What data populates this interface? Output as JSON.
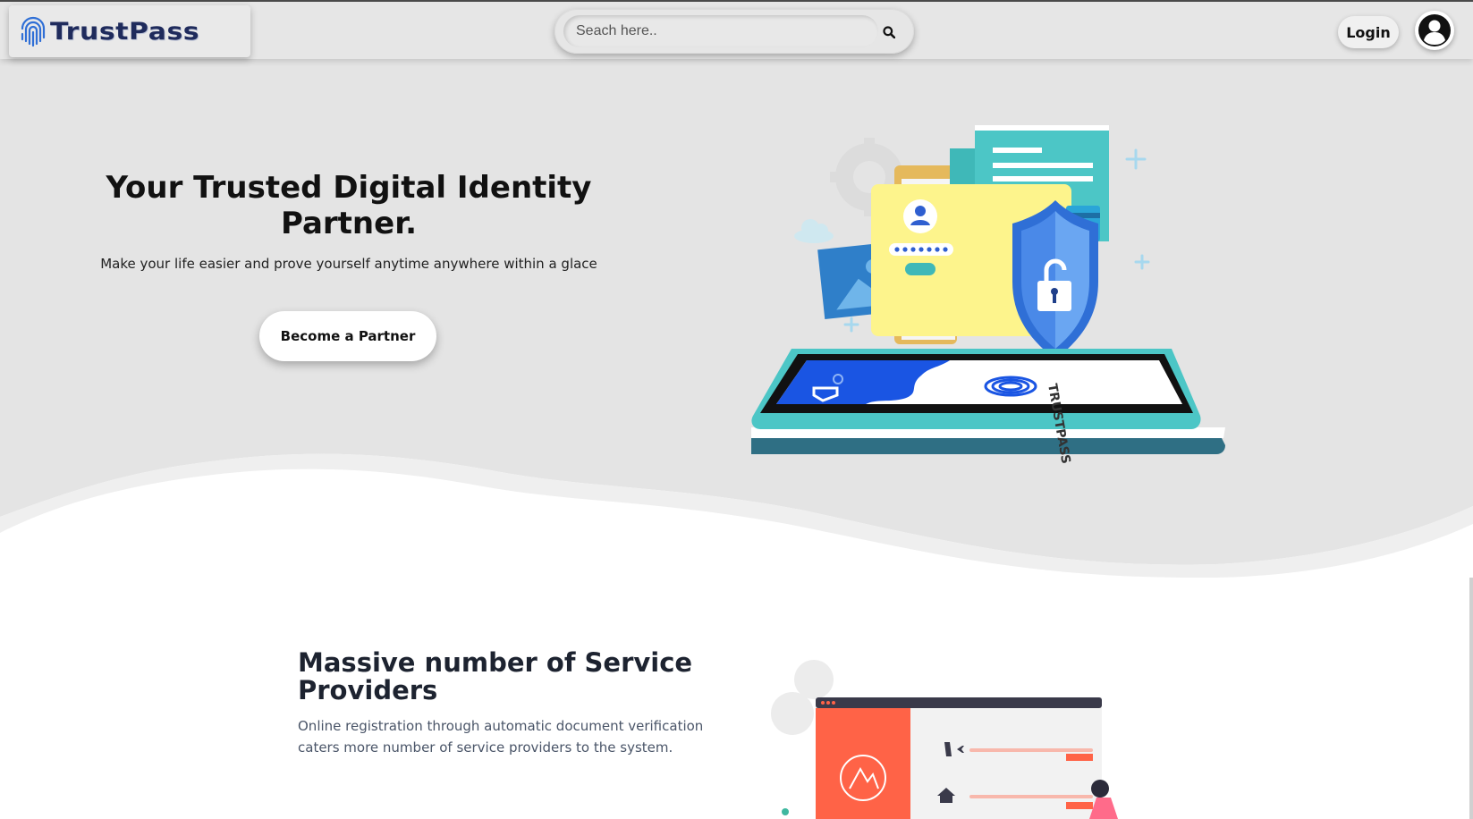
{
  "header": {
    "logo_text": "TrustPass",
    "search_placeholder": "Seach here..",
    "login_label": "Login"
  },
  "hero": {
    "title": "Your Trusted Digital Identity Partner.",
    "subtitle": "Make your life easier and prove yourself anytime anywhere within a glace",
    "cta_label": "Become a Partner",
    "phone_logo_text": "TRUSTPASS"
  },
  "features": {
    "title": "Massive number of Service Providers",
    "description": "Online registration through automatic document verification caters more number of service providers to the system."
  },
  "colors": {
    "hero_bg": "#e4e4e4",
    "brand_dark": "#1f2b5c",
    "brand_blue": "#2f6fd6",
    "teal": "#4cc6c6",
    "accent_red": "#ff6347"
  }
}
